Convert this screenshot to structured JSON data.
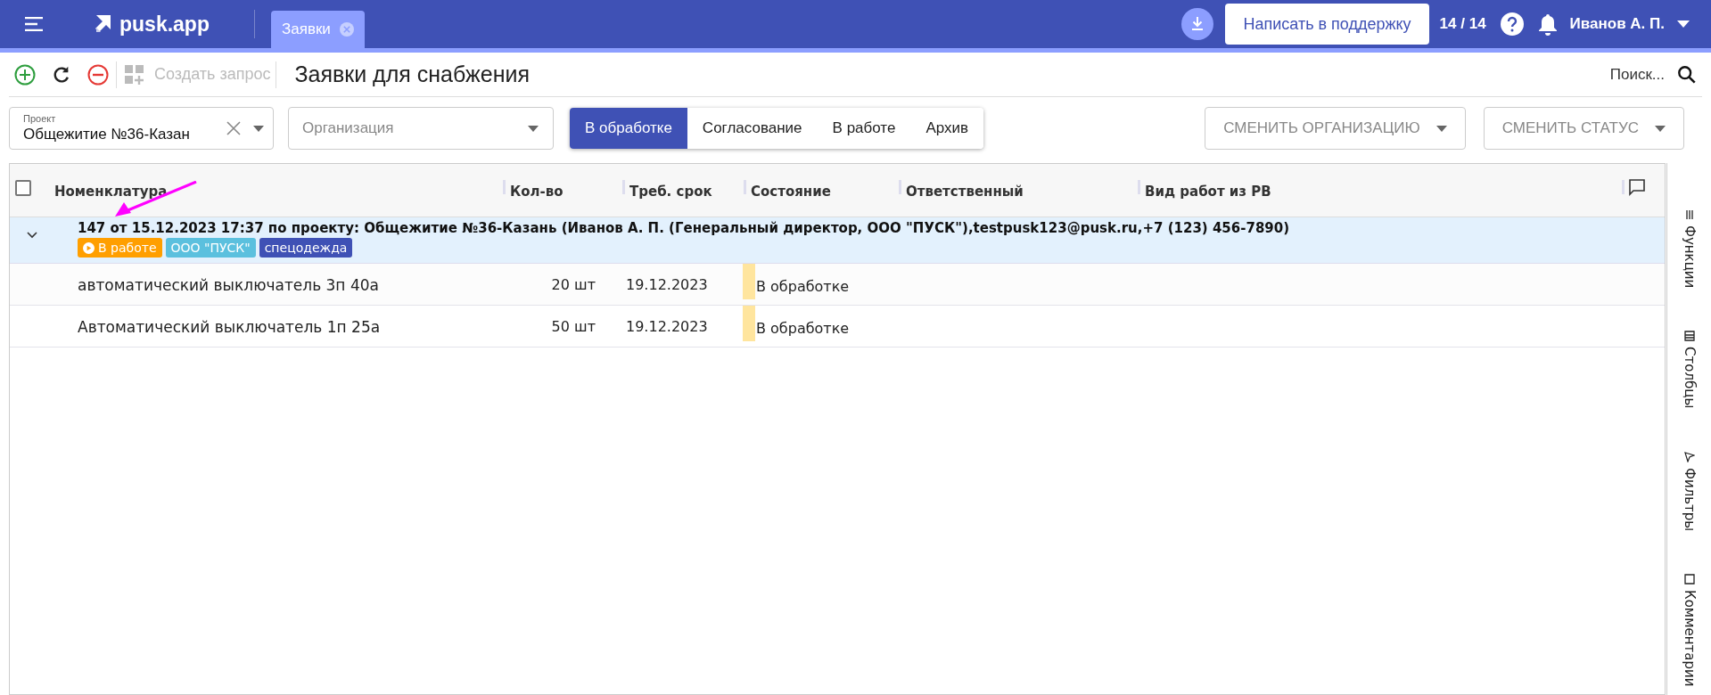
{
  "app_bar": {
    "logo": "pusk.app",
    "tabs": [
      {
        "label": "Заявки",
        "selected": true
      }
    ],
    "support_button": "Написать в поддержку",
    "counter": "14 / 14",
    "user": "Иванов А. П."
  },
  "toolbar": {
    "create_request": "Создать запрос",
    "title": "Заявки для снабжения",
    "search_placeholder": "Поиск..."
  },
  "filters": {
    "project": {
      "label": "Проект",
      "value": "Общежитие №36-Казан"
    },
    "organization": {
      "placeholder": "Организация"
    },
    "status_tabs": [
      {
        "label": "В обработке",
        "selected": true
      },
      {
        "label": "Согласование",
        "selected": false
      },
      {
        "label": "В работе",
        "selected": false
      },
      {
        "label": "Архив",
        "selected": false
      }
    ],
    "buttons": [
      "СМЕНИТЬ ОРГАНИЗАЦИЮ",
      "СМЕНИТЬ СТАТУС"
    ]
  },
  "table": {
    "select_all_checked": false,
    "columns": [
      "Номенклатура",
      "Кол-во",
      "Треб. срок",
      "Состояние",
      "Ответственный",
      "Вид работ из РВ"
    ],
    "groups": [
      {
        "title": "147 от 15.12.2023 17:37 по проекту: Общежитие №36-Казань (Иванов А. П. (Генеральный директор, ООО \"ПУСК\"),testpusk123@pusk.ru,+7 (123) 456-7890)",
        "expanded": true,
        "tags": [
          {
            "kind": "status",
            "label": "В работе",
            "color": "#ff9f00"
          },
          {
            "kind": "tag",
            "label": "ООО \"ПУСК\"",
            "color": "#5bc0de"
          },
          {
            "kind": "tag",
            "label": "спецодежда",
            "color": "#3f51b5"
          }
        ],
        "rows": [
          {
            "name": "автоматический выключатель 3п 40а",
            "qty": "20 шт",
            "due": "19.12.2023",
            "state": "В обработке"
          },
          {
            "name": "Автоматический выключатель 1п 25а",
            "qty": "50 шт",
            "due": "19.12.2023",
            "state": "В обработке"
          }
        ]
      }
    ]
  },
  "side_panel": [
    "Функции",
    "Столбцы",
    "Фильтры",
    "Комментарии"
  ]
}
